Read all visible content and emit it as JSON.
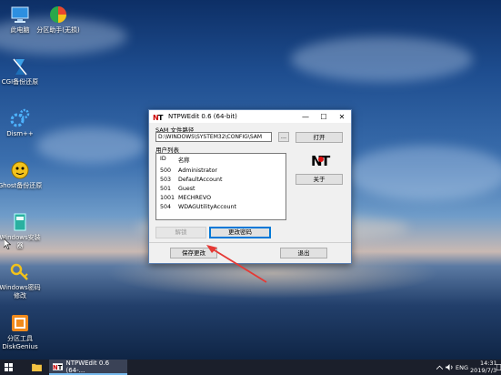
{
  "desktop": {
    "icons": [
      {
        "name": "this-pc-icon",
        "label": "此电脑"
      },
      {
        "name": "partition-assistant-icon",
        "label": "分区助手(无损)"
      },
      {
        "name": "cgi-backup-icon",
        "label": "CGI备份还原"
      },
      {
        "name": "dism-icon",
        "label": "Dism++"
      },
      {
        "name": "ghost-backup-icon",
        "label": "Ghost备份还原"
      },
      {
        "name": "windows-installer-icon",
        "label": "Windows安装器"
      },
      {
        "name": "windows-password-icon",
        "label": "Windows密码修改"
      },
      {
        "name": "diskgenius-icon",
        "label": "分区工具DiskGenius"
      }
    ]
  },
  "dialog": {
    "title": "NTPWEdit 0.6 (64-bit)",
    "minimize": "—",
    "maximize": "☐",
    "close": "✕",
    "sam_label": "SAM 文件路径",
    "sam_path": "D:\\WINDOWS\\SYSTEM32\\CONFIG\\SAM",
    "browse_label": "...",
    "open_label": "打开",
    "user_list_label": "用户列表",
    "columns": [
      "ID",
      "名称"
    ],
    "users": [
      {
        "id": "500",
        "name": "Administrator"
      },
      {
        "id": "503",
        "name": "DefaultAccount"
      },
      {
        "id": "501",
        "name": "Guest"
      },
      {
        "id": "1001",
        "name": "MECHREVO"
      },
      {
        "id": "504",
        "name": "WDAGUtilityAccount"
      }
    ],
    "logo_text": "NT",
    "about_label": "关于",
    "unlock_label": "解锁",
    "change_password_label": "更改密码",
    "save_label": "保存更改",
    "exit_label": "退出"
  },
  "taskbar": {
    "app_label": "NTPWEdit 0.6 (64-...",
    "lang": "ENG",
    "time": "14:31",
    "date": "2019/7/3"
  },
  "colors": {
    "accent": "#0078d7",
    "arrow": "#e53935",
    "taskbar": "#1b1f2b"
  }
}
